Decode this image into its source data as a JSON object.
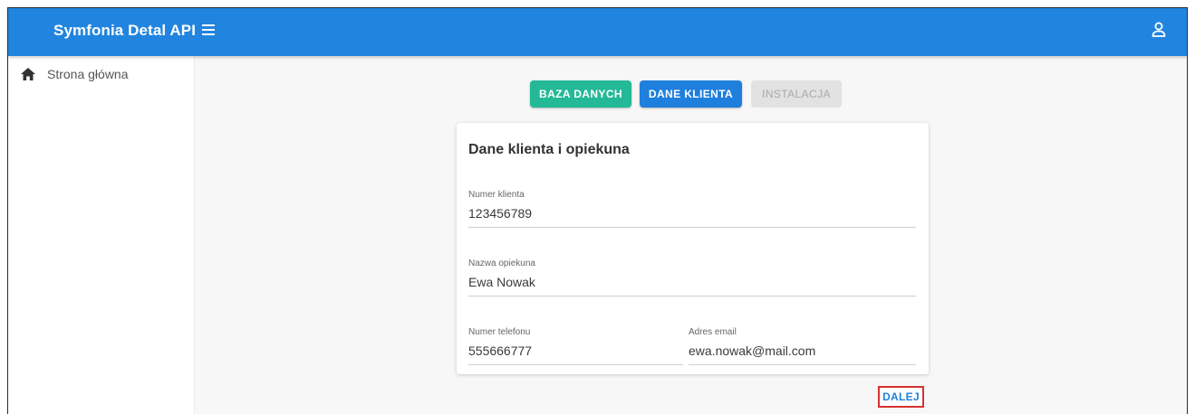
{
  "app": {
    "title": "Symfonia Detal API"
  },
  "sidebar": {
    "items": [
      {
        "label": "Strona główna",
        "icon": "home-icon"
      }
    ]
  },
  "steps": [
    {
      "label": "BAZA DANYCH",
      "state": "completed",
      "color": "#23b997"
    },
    {
      "label": "DANE KLIENTA",
      "state": "active",
      "color": "#1f7fdc"
    },
    {
      "label": "INSTALACJA",
      "state": "disabled",
      "color": "#e2e2e2"
    }
  ],
  "form": {
    "title": "Dane klienta i opiekuna",
    "fields": {
      "client_number": {
        "label": "Numer klienta",
        "value": "123456789"
      },
      "keeper_name": {
        "label": "Nazwa opiekuna",
        "value": "Ewa Nowak"
      },
      "phone": {
        "label": "Numer telefonu",
        "value": "555666777"
      },
      "email": {
        "label": "Adres email",
        "value": "ewa.nowak@mail.com"
      }
    }
  },
  "actions": {
    "next_label": "DALEJ"
  },
  "colors": {
    "appbar": "#2185e0",
    "primary": "#1f7fdc",
    "success": "#23b997",
    "highlight_border": "#d4322f"
  }
}
